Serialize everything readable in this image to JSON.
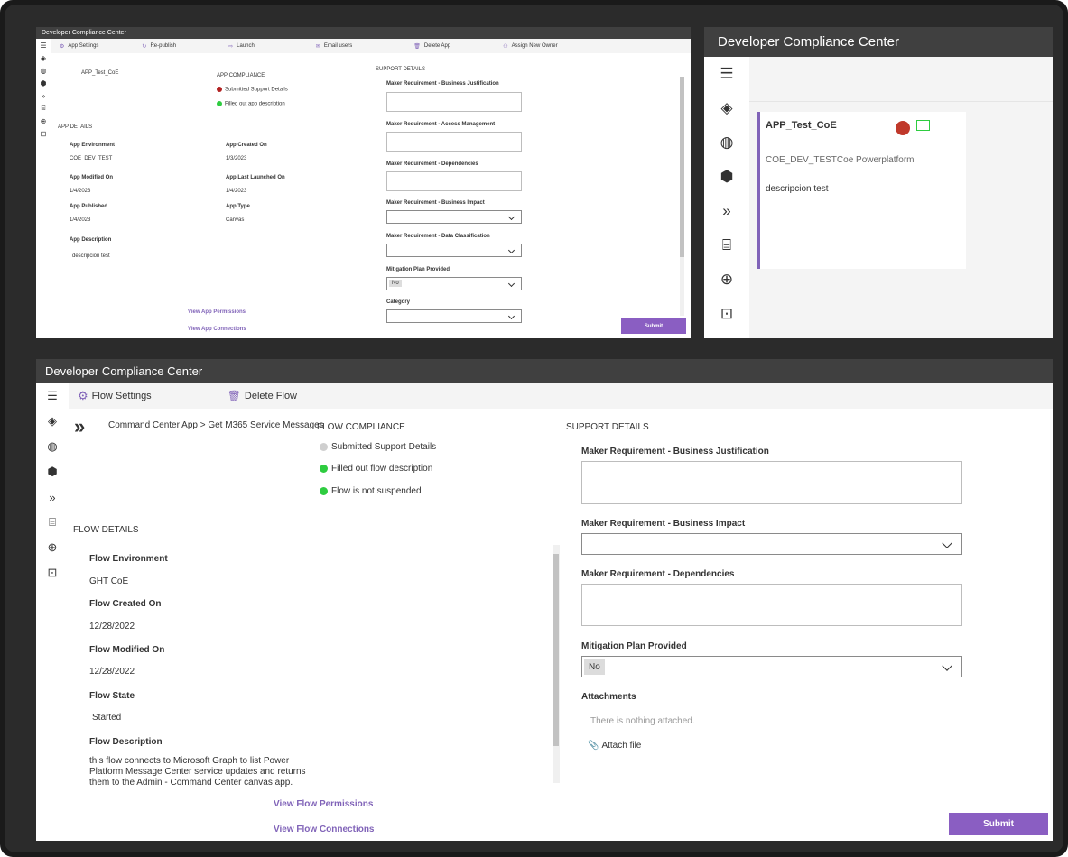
{
  "app_panel": {
    "title": "Developer Compliance Center",
    "toolbar": {
      "app_settings": "App Settings",
      "republish": "Re-publish",
      "launch": "Launch",
      "email_users": "Email users",
      "delete_app": "Delete App",
      "assign_owner": "Assign New Owner"
    },
    "app_name": "APP_Test_CoE",
    "compliance": {
      "heading": "APP COMPLIANCE",
      "items": [
        {
          "label": "Submitted Support Details",
          "color": "#b22222"
        },
        {
          "label": "Filled out app description",
          "color": "#2ecc40"
        }
      ]
    },
    "details": {
      "heading": "APP DETAILS",
      "env_label": "App Environment",
      "env_value": "COE_DEV_TEST",
      "created_label": "App Created On",
      "created_value": "1/3/2023",
      "modified_label": "App Modified On",
      "modified_value": "1/4/2023",
      "launched_label": "App Last Launched On",
      "launched_value": "1/4/2023",
      "published_label": "App Published",
      "published_value": "1/4/2023",
      "type_label": "App Type",
      "type_value": "Canvas",
      "desc_label": "App Description",
      "desc_value": "descripcion test"
    },
    "links": {
      "permissions": "View App Permissions",
      "connections": "View App Connections"
    },
    "support": {
      "heading": "SUPPORT DETAILS",
      "justification": "Maker Requirement - Business Justification",
      "access": "Maker Requirement - Access Management",
      "dependencies": "Maker Requirement - Dependencies",
      "impact": "Maker Requirement - Business Impact",
      "classification": "Maker Requirement - Data Classification",
      "mitigation": "Mitigation Plan Provided",
      "mitigation_value": "No",
      "category": "Category"
    },
    "submit": "Submit"
  },
  "card_panel": {
    "title": "Developer Compliance Center",
    "card": {
      "name": "APP_Test_CoE",
      "line1": "COE_DEV_TESTCoe Powerplatform",
      "line2": "descripcion test",
      "status_color": "#c0392b",
      "accent": "#8063b8"
    }
  },
  "flow_panel": {
    "title": "Developer Compliance Center",
    "toolbar": {
      "flow_settings": "Flow Settings",
      "delete_flow": "Delete Flow"
    },
    "breadcrumb": "Command Center App > Get M365 Service Messages",
    "compliance": {
      "heading": "FLOW COMPLIANCE",
      "items": [
        {
          "label": "Submitted Support Details",
          "color": "#cfcfcf"
        },
        {
          "label": "Filled out flow description",
          "color": "#2ecc40"
        },
        {
          "label": "Flow is not suspended",
          "color": "#2ecc40"
        }
      ]
    },
    "details": {
      "heading": "FLOW DETAILS",
      "env_label": "Flow Environment",
      "env_value": "GHT CoE",
      "created_label": "Flow Created On",
      "created_value": "12/28/2022",
      "modified_label": "Flow Modified On",
      "modified_value": "12/28/2022",
      "state_label": "Flow State",
      "state_value": "Started",
      "desc_label": "Flow Description",
      "desc_lines": [
        "this flow connects to Microsoft Graph to list Power",
        "Platform Message Center service updates and returns",
        "them to the Admin - Command Center canvas app."
      ]
    },
    "links": {
      "permissions": "View Flow Permissions",
      "connections": "View Flow Connections"
    },
    "support": {
      "heading": "SUPPORT DETAILS",
      "justification": "Maker Requirement - Business Justification",
      "impact": "Maker Requirement - Business Impact",
      "dependencies": "Maker Requirement - Dependencies",
      "mitigation": "Mitigation Plan Provided",
      "mitigation_value": "No",
      "attachments": "Attachments",
      "no_attachments": "There is nothing attached.",
      "attach_file": "Attach file"
    },
    "submit": "Submit"
  }
}
